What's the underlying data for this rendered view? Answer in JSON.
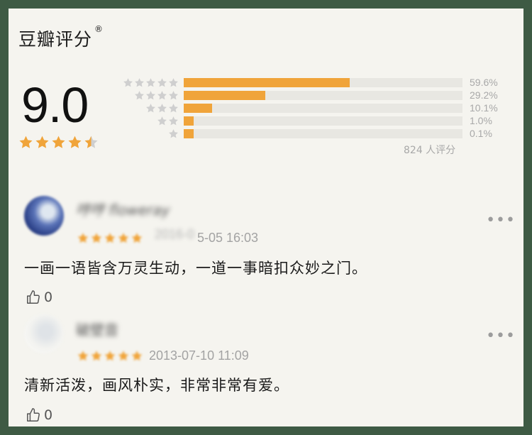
{
  "header": {
    "title": "豆瓣评分",
    "mark": "®"
  },
  "rating": {
    "score": "9.0",
    "stars_value": 4.5,
    "distribution": [
      {
        "stars": 5,
        "percent_label": "59.6%",
        "percent": 59.6
      },
      {
        "stars": 4,
        "percent_label": "29.2%",
        "percent": 29.2
      },
      {
        "stars": 3,
        "percent_label": "10.1%",
        "percent": 10.1
      },
      {
        "stars": 2,
        "percent_label": "1.0%",
        "percent": 1.0
      },
      {
        "stars": 1,
        "percent_label": "0.1%",
        "percent": 0.1
      }
    ],
    "count_label": "824 人评分"
  },
  "reviews": [
    {
      "username": "哼哼 floweray",
      "stars": 5,
      "date_hidden": "2016-0",
      "date_visible": "5-05 16:03",
      "text": "一画一语皆含万灵生动，一道一事暗扣众妙之门。",
      "likes": "0",
      "more": "•••"
    },
    {
      "username": "破壁音",
      "stars": 5,
      "date_visible": "2013-07-10 11:09",
      "text": "清新活泼，画风朴实，非常非常有爱。",
      "likes": "0",
      "more": "•••"
    }
  ],
  "colors": {
    "accent": "#f0a43a",
    "star_gray": "#cfcfcf",
    "background": "#f5f4ef",
    "frame": "#3e5a44"
  }
}
